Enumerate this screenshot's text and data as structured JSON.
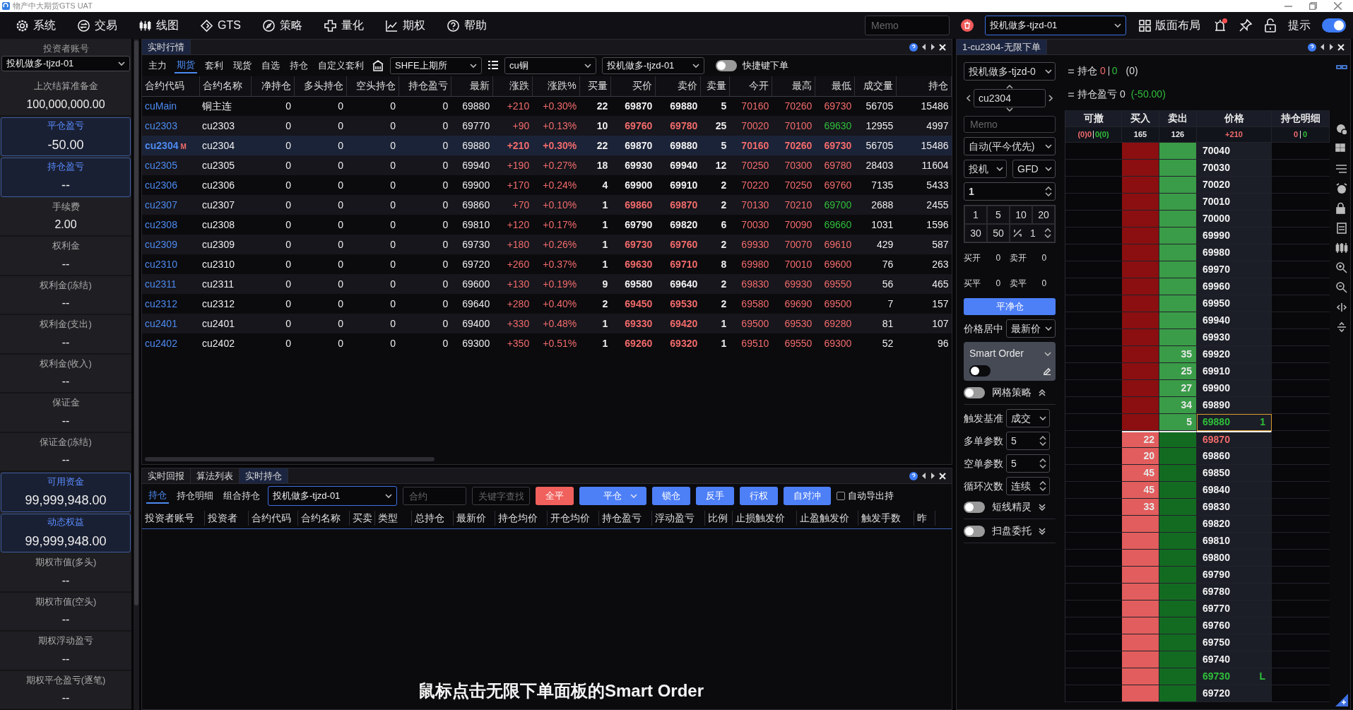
{
  "window": {
    "title": "物产中大期货GTS UAT"
  },
  "menu": [
    "系统",
    "交易",
    "线图",
    "GTS",
    "策略",
    "量化",
    "期权",
    "帮助"
  ],
  "toolbar": {
    "memo_placeholder": "Memo",
    "account": "投机做多-tjzd-01",
    "layout_label": "版面布局",
    "alert": true,
    "hint_label": "提示",
    "hint_on": true
  },
  "account_panel": {
    "title": "投资者账号",
    "account": "投机做多-tjzd-01",
    "fields": [
      {
        "label": "上次结算准备金",
        "value": "100,000,000.00",
        "highlighted": false
      },
      {
        "label": "平仓盈亏",
        "value": "-50.00",
        "highlighted": true
      },
      {
        "label": "持仓盈亏",
        "value": "--",
        "highlighted": true
      },
      {
        "label": "手续费",
        "value": "2.00",
        "highlighted": false
      },
      {
        "label": "权利金",
        "value": "--",
        "highlighted": false
      },
      {
        "label": "权利金(冻结)",
        "value": "--",
        "highlighted": false
      },
      {
        "label": "权利金(支出)",
        "value": "--",
        "highlighted": false
      },
      {
        "label": "权利金(收入)",
        "value": "--",
        "highlighted": false
      },
      {
        "label": "保证金",
        "value": "--",
        "highlighted": false
      },
      {
        "label": "保证金(冻结)",
        "value": "--",
        "highlighted": false
      },
      {
        "label": "可用资金",
        "value": "99,999,948.00",
        "highlighted": true
      },
      {
        "label": "动态权益",
        "value": "99,999,948.00",
        "highlighted": true
      },
      {
        "label": "期权市值(多头)",
        "value": "--",
        "highlighted": false
      },
      {
        "label": "期权市值(空头)",
        "value": "--",
        "highlighted": false
      },
      {
        "label": "期权浮动盈亏",
        "value": "--",
        "highlighted": false
      },
      {
        "label": "期权平仓盈亏(逐笔)",
        "value": "--",
        "highlighted": false
      }
    ]
  },
  "quotes": {
    "tab": "实时行情",
    "categories": [
      {
        "label": "主力",
        "selected": false
      },
      {
        "label": "期货",
        "selected": true
      },
      {
        "label": "套利",
        "selected": false
      },
      {
        "label": "现货",
        "selected": false
      },
      {
        "label": "自选",
        "selected": false
      },
      {
        "label": "持仓",
        "selected": false
      },
      {
        "label": "自定义套利",
        "selected": false
      }
    ],
    "exchange": "SHFE上期所",
    "product": "cu铜",
    "account": "投机做多-tjzd-01",
    "hotkey_label": "快捷键下单",
    "hotkey_on": false,
    "columns": [
      "合约代码",
      "合约名称",
      "净持仓",
      "多头持仓",
      "空头持仓",
      "持仓盈亏",
      "最新",
      "涨跌",
      "涨跌%",
      "买量",
      "买价",
      "卖价",
      "卖量",
      "今开",
      "最高",
      "最低",
      "成交量",
      "持仓"
    ],
    "rows": [
      {
        "code": "cuMain",
        "name": "铜主连",
        "net": "0",
        "long": "0",
        "short": "0",
        "pnl": "0",
        "last": "69880",
        "change": {
          "value": "+210",
          "color": "#f26b6b"
        },
        "change_pct": {
          "value": "+0.30%",
          "color": "#f26b6b"
        },
        "bid_vol": "22",
        "bid": {
          "value": "69870",
          "color": "#f2f2f2"
        },
        "ask": {
          "value": "69880",
          "color": "#f2f2f2"
        },
        "ask_vol": "5",
        "open": {
          "value": "70160",
          "color": "#f26b6b"
        },
        "high": {
          "value": "70260",
          "color": "#f26b6b"
        },
        "low": {
          "value": "69730",
          "color": "#f26b6b"
        },
        "volume": "56705",
        "open_interest": "15486",
        "selected": false
      },
      {
        "code": "cu2303",
        "name": "cu2303",
        "net": "0",
        "long": "0",
        "short": "0",
        "pnl": "0",
        "last": "69770",
        "change": {
          "value": "+90",
          "color": "#f26b6b"
        },
        "change_pct": {
          "value": "+0.13%",
          "color": "#f26b6b"
        },
        "bid_vol": "10",
        "bid": {
          "value": "69760",
          "color": "#f26b6b"
        },
        "ask": {
          "value": "69780",
          "color": "#f26b6b"
        },
        "ask_vol": "25",
        "open": {
          "value": "70020",
          "color": "#f26b6b"
        },
        "high": {
          "value": "70100",
          "color": "#f26b6b"
        },
        "low": {
          "value": "69630",
          "color": "#2fbf3a"
        },
        "volume": "12955",
        "open_interest": "4997",
        "selected": false
      },
      {
        "code": "cu2304",
        "marker": "M",
        "name": "cu2304",
        "net": "0",
        "long": "0",
        "short": "0",
        "pnl": "0",
        "last": "69880",
        "change": {
          "value": "+210",
          "color": "#f26b6b"
        },
        "change_pct": {
          "value": "+0.30%",
          "color": "#f26b6b"
        },
        "bid_vol": "22",
        "bid": {
          "value": "69870",
          "color": "#f2f2f2"
        },
        "ask": {
          "value": "69880",
          "color": "#f2f2f2"
        },
        "ask_vol": "5",
        "open": {
          "value": "70160",
          "color": "#f26b6b"
        },
        "high": {
          "value": "70260",
          "color": "#f26b6b"
        },
        "low": {
          "value": "69730",
          "color": "#f26b6b"
        },
        "volume": "56705",
        "open_interest": "15486",
        "selected": true
      },
      {
        "code": "cu2305",
        "name": "cu2305",
        "net": "0",
        "long": "0",
        "short": "0",
        "pnl": "0",
        "last": "69940",
        "change": {
          "value": "+190",
          "color": "#f26b6b"
        },
        "change_pct": {
          "value": "+0.27%",
          "color": "#f26b6b"
        },
        "bid_vol": "18",
        "bid": {
          "value": "69930",
          "color": "#f2f2f2"
        },
        "ask": {
          "value": "69940",
          "color": "#f2f2f2"
        },
        "ask_vol": "12",
        "open": {
          "value": "70250",
          "color": "#f26b6b"
        },
        "high": {
          "value": "70300",
          "color": "#f26b6b"
        },
        "low": {
          "value": "69780",
          "color": "#f26b6b"
        },
        "volume": "28403",
        "open_interest": "11604",
        "selected": false
      },
      {
        "code": "cu2306",
        "name": "cu2306",
        "net": "0",
        "long": "0",
        "short": "0",
        "pnl": "0",
        "last": "69900",
        "change": {
          "value": "+170",
          "color": "#f26b6b"
        },
        "change_pct": {
          "value": "+0.24%",
          "color": "#f26b6b"
        },
        "bid_vol": "4",
        "bid": {
          "value": "69900",
          "color": "#f2f2f2"
        },
        "ask": {
          "value": "69910",
          "color": "#f2f2f2"
        },
        "ask_vol": "2",
        "open": {
          "value": "70220",
          "color": "#f26b6b"
        },
        "high": {
          "value": "70250",
          "color": "#f26b6b"
        },
        "low": {
          "value": "69760",
          "color": "#f26b6b"
        },
        "volume": "7135",
        "open_interest": "5433",
        "selected": false
      },
      {
        "code": "cu2307",
        "name": "cu2307",
        "net": "0",
        "long": "0",
        "short": "0",
        "pnl": "0",
        "last": "69860",
        "change": {
          "value": "+70",
          "color": "#f26b6b"
        },
        "change_pct": {
          "value": "+0.10%",
          "color": "#f26b6b"
        },
        "bid_vol": "1",
        "bid": {
          "value": "69860",
          "color": "#f26b6b"
        },
        "ask": {
          "value": "69870",
          "color": "#f26b6b"
        },
        "ask_vol": "2",
        "open": {
          "value": "70130",
          "color": "#f26b6b"
        },
        "high": {
          "value": "70210",
          "color": "#f26b6b"
        },
        "low": {
          "value": "69700",
          "color": "#2fbf3a"
        },
        "volume": "2688",
        "open_interest": "2455",
        "selected": false
      },
      {
        "code": "cu2308",
        "name": "cu2308",
        "net": "0",
        "long": "0",
        "short": "0",
        "pnl": "0",
        "last": "69810",
        "change": {
          "value": "+120",
          "color": "#f26b6b"
        },
        "change_pct": {
          "value": "+0.17%",
          "color": "#f26b6b"
        },
        "bid_vol": "1",
        "bid": {
          "value": "69790",
          "color": "#f2f2f2"
        },
        "ask": {
          "value": "69820",
          "color": "#f2f2f2"
        },
        "ask_vol": "6",
        "open": {
          "value": "70030",
          "color": "#f26b6b"
        },
        "high": {
          "value": "70090",
          "color": "#f26b6b"
        },
        "low": {
          "value": "69660",
          "color": "#2fbf3a"
        },
        "volume": "1031",
        "open_interest": "1596",
        "selected": false
      },
      {
        "code": "cu2309",
        "name": "cu2309",
        "net": "0",
        "long": "0",
        "short": "0",
        "pnl": "0",
        "last": "69730",
        "change": {
          "value": "+180",
          "color": "#f26b6b"
        },
        "change_pct": {
          "value": "+0.26%",
          "color": "#f26b6b"
        },
        "bid_vol": "1",
        "bid": {
          "value": "69730",
          "color": "#f26b6b"
        },
        "ask": {
          "value": "69760",
          "color": "#f26b6b"
        },
        "ask_vol": "2",
        "open": {
          "value": "69930",
          "color": "#f26b6b"
        },
        "high": {
          "value": "70070",
          "color": "#f26b6b"
        },
        "low": {
          "value": "69610",
          "color": "#f26b6b"
        },
        "volume": "429",
        "open_interest": "587",
        "selected": false
      },
      {
        "code": "cu2310",
        "name": "cu2310",
        "net": "0",
        "long": "0",
        "short": "0",
        "pnl": "0",
        "last": "69720",
        "change": {
          "value": "+260",
          "color": "#f26b6b"
        },
        "change_pct": {
          "value": "+0.37%",
          "color": "#f26b6b"
        },
        "bid_vol": "1",
        "bid": {
          "value": "69630",
          "color": "#f26b6b"
        },
        "ask": {
          "value": "69710",
          "color": "#f26b6b"
        },
        "ask_vol": "8",
        "open": {
          "value": "69980",
          "color": "#f26b6b"
        },
        "high": {
          "value": "70010",
          "color": "#f26b6b"
        },
        "low": {
          "value": "69600",
          "color": "#f26b6b"
        },
        "volume": "76",
        "open_interest": "263",
        "selected": false
      },
      {
        "code": "cu2311",
        "name": "cu2311",
        "net": "0",
        "long": "0",
        "short": "0",
        "pnl": "0",
        "last": "69600",
        "change": {
          "value": "+130",
          "color": "#f26b6b"
        },
        "change_pct": {
          "value": "+0.19%",
          "color": "#f26b6b"
        },
        "bid_vol": "9",
        "bid": {
          "value": "69580",
          "color": "#f2f2f2"
        },
        "ask": {
          "value": "69640",
          "color": "#f2f2f2"
        },
        "ask_vol": "2",
        "open": {
          "value": "69830",
          "color": "#f26b6b"
        },
        "high": {
          "value": "69930",
          "color": "#f26b6b"
        },
        "low": {
          "value": "69550",
          "color": "#f26b6b"
        },
        "volume": "56",
        "open_interest": "465",
        "selected": false
      },
      {
        "code": "cu2312",
        "name": "cu2312",
        "net": "0",
        "long": "0",
        "short": "0",
        "pnl": "0",
        "last": "69640",
        "change": {
          "value": "+280",
          "color": "#f26b6b"
        },
        "change_pct": {
          "value": "+0.40%",
          "color": "#f26b6b"
        },
        "bid_vol": "2",
        "bid": {
          "value": "69450",
          "color": "#f26b6b"
        },
        "ask": {
          "value": "69530",
          "color": "#f26b6b"
        },
        "ask_vol": "2",
        "open": {
          "value": "69580",
          "color": "#f26b6b"
        },
        "high": {
          "value": "69690",
          "color": "#f26b6b"
        },
        "low": {
          "value": "69500",
          "color": "#f26b6b"
        },
        "volume": "7",
        "open_interest": "157",
        "selected": false
      },
      {
        "code": "cu2401",
        "name": "cu2401",
        "net": "0",
        "long": "0",
        "short": "0",
        "pnl": "0",
        "last": "69400",
        "change": {
          "value": "+330",
          "color": "#f26b6b"
        },
        "change_pct": {
          "value": "+0.48%",
          "color": "#f26b6b"
        },
        "bid_vol": "1",
        "bid": {
          "value": "69330",
          "color": "#f26b6b"
        },
        "ask": {
          "value": "69420",
          "color": "#f26b6b"
        },
        "ask_vol": "1",
        "open": {
          "value": "69500",
          "color": "#f26b6b"
        },
        "high": {
          "value": "69530",
          "color": "#f26b6b"
        },
        "low": {
          "value": "69280",
          "color": "#f26b6b"
        },
        "volume": "81",
        "open_interest": "107",
        "selected": false
      },
      {
        "code": "cu2402",
        "name": "cu2402",
        "net": "0",
        "long": "0",
        "short": "0",
        "pnl": "0",
        "last": "69300",
        "change": {
          "value": "+350",
          "color": "#f26b6b"
        },
        "change_pct": {
          "value": "+0.51%",
          "color": "#f26b6b"
        },
        "bid_vol": "1",
        "bid": {
          "value": "69260",
          "color": "#f26b6b"
        },
        "ask": {
          "value": "69320",
          "color": "#f26b6b"
        },
        "ask_vol": "1",
        "open": {
          "value": "69510",
          "color": "#f26b6b"
        },
        "high": {
          "value": "69550",
          "color": "#f26b6b"
        },
        "low": {
          "value": "69300",
          "color": "#f26b6b"
        },
        "volume": "52",
        "open_interest": "96",
        "selected": false
      }
    ]
  },
  "positions": {
    "tabs": [
      {
        "label": "实时回报",
        "selected": false
      },
      {
        "label": "算法列表",
        "selected": false
      },
      {
        "label": "实时持仓",
        "selected": true
      }
    ],
    "subtabs": [
      {
        "label": "持仓",
        "selected": true
      },
      {
        "label": "持仓明细",
        "selected": false
      },
      {
        "label": "组合持仓",
        "selected": false
      }
    ],
    "account": "投机做多-tjzd-01",
    "contract_placeholder": "合约",
    "keyword_placeholder": "关键字查找",
    "buttons": [
      {
        "label": "全平",
        "kind": "danger"
      },
      {
        "label": "平仓",
        "kind": "dropdown"
      },
      {
        "label": "锁仓",
        "kind": "primary"
      },
      {
        "label": "反手",
        "kind": "primary"
      },
      {
        "label": "行权",
        "kind": "primary"
      },
      {
        "label": "自对冲",
        "kind": "primary"
      }
    ],
    "auto_export": {
      "label": "自动导出持",
      "checked": false
    },
    "columns": [
      "投资者账号",
      "投资者",
      "合约代码",
      "合约名称",
      "买卖",
      "类型",
      "总持仓",
      "最新价",
      "持仓均价",
      "开仓均价",
      "持仓盈亏",
      "浮动盈亏",
      "比例",
      "止损触发价",
      "止盈触发价",
      "触发手数",
      "昨"
    ],
    "caption": "鼠标点击无限下单面板的Smart Order"
  },
  "order_panel": {
    "tab": "1-cu2304-无限下单",
    "account": "投机做多-tjzd-0",
    "contract": "cu2304",
    "memo_placeholder": "Memo",
    "mode": "自动(平今优先)",
    "hedge": "投机",
    "tif": "GFD",
    "quantity": "1",
    "quick_quantities": [
      "1",
      "5",
      "10",
      "20",
      "30",
      "50"
    ],
    "multiplier": "1",
    "stats": [
      {
        "label": "买开",
        "value": "0"
      },
      {
        "label": "卖开",
        "value": "0"
      },
      {
        "label": "买平",
        "value": "0"
      },
      {
        "label": "卖平",
        "value": "0"
      }
    ],
    "flatten_button": "平净仓",
    "center_label": "价格居中",
    "center_mode": "最新价",
    "smart_order": {
      "label": "Smart Order",
      "on": false
    },
    "grid_strategy": {
      "label": "网格策略",
      "on": false,
      "expanded": true
    },
    "params": [
      {
        "label": "触发基准",
        "value": "成交",
        "kind": "select"
      },
      {
        "label": "多单参数",
        "value": "5",
        "kind": "spin"
      },
      {
        "label": "空单参数",
        "value": "5",
        "kind": "spin"
      },
      {
        "label": "循环次数",
        "value": "连续",
        "kind": "spin"
      }
    ],
    "extras": [
      {
        "label": "短线精灵",
        "on": false,
        "expanded": false
      },
      {
        "label": "扫盘委托",
        "on": false,
        "expanded": false
      }
    ],
    "position": {
      "label": "持仓",
      "long": "0",
      "short": "0",
      "total": "(0)"
    },
    "pnl": {
      "label": "持仓盈亏",
      "value": "0",
      "close": "(-50.00)"
    },
    "ladder": {
      "columns": [
        "可撤",
        "买入",
        "卖出",
        "价格",
        "持仓明细"
      ],
      "summary": {
        "cancel_buy": "(0)0",
        "cancel_sell": "0(0)",
        "buy": "165",
        "sell": "126",
        "change": "+210",
        "hold_long": "0",
        "hold_short": "0"
      },
      "rows": [
        {
          "price": "70040",
          "kind": "ask",
          "color": "#f2f2f2",
          "current": false
        },
        {
          "price": "70030",
          "kind": "ask",
          "color": "#f2f2f2",
          "current": false
        },
        {
          "price": "70020",
          "kind": "ask",
          "color": "#f2f2f2",
          "current": false
        },
        {
          "price": "70010",
          "kind": "ask",
          "color": "#f2f2f2",
          "current": false
        },
        {
          "price": "70000",
          "kind": "ask",
          "color": "#f2f2f2",
          "current": false
        },
        {
          "price": "69990",
          "kind": "ask",
          "color": "#f2f2f2",
          "current": false
        },
        {
          "price": "69980",
          "kind": "ask",
          "color": "#f2f2f2",
          "current": false
        },
        {
          "price": "69970",
          "kind": "ask",
          "color": "#f2f2f2",
          "current": false
        },
        {
          "price": "69960",
          "kind": "ask",
          "color": "#f2f2f2",
          "current": false
        },
        {
          "price": "69950",
          "kind": "ask",
          "color": "#f2f2f2",
          "current": false
        },
        {
          "price": "69940",
          "kind": "ask",
          "color": "#f2f2f2",
          "current": false
        },
        {
          "price": "69930",
          "kind": "ask",
          "color": "#f2f2f2",
          "current": false
        },
        {
          "price": "69920",
          "ask": "35",
          "kind": "ask",
          "color": "#f2f2f2",
          "current": false
        },
        {
          "price": "69910",
          "ask": "25",
          "kind": "ask",
          "color": "#f2f2f2",
          "current": false
        },
        {
          "price": "69900",
          "ask": "27",
          "kind": "ask",
          "color": "#f2f2f2",
          "current": false
        },
        {
          "price": "69890",
          "ask": "34",
          "kind": "ask",
          "color": "#f2f2f2",
          "current": false
        },
        {
          "price": "69880",
          "ask": "5",
          "kind": "ask",
          "color": "#2fbf3a",
          "current": true,
          "flag": "1"
        },
        {
          "price": "69870",
          "bid": "22",
          "kind": "bid",
          "color": "#f26b6b",
          "current": false
        },
        {
          "price": "69860",
          "bid": "20",
          "kind": "bid",
          "color": "#f2f2f2",
          "current": false
        },
        {
          "price": "69850",
          "bid": "45",
          "kind": "bid",
          "color": "#f2f2f2",
          "current": false
        },
        {
          "price": "69840",
          "bid": "45",
          "kind": "bid",
          "color": "#f2f2f2",
          "current": false
        },
        {
          "price": "69830",
          "bid": "33",
          "kind": "bid",
          "color": "#f2f2f2",
          "current": false
        },
        {
          "price": "69820",
          "kind": "bid",
          "color": "#f2f2f2",
          "current": false
        },
        {
          "price": "69810",
          "kind": "bid",
          "color": "#f2f2f2",
          "current": false
        },
        {
          "price": "69800",
          "kind": "bid",
          "color": "#f2f2f2",
          "current": false
        },
        {
          "price": "69790",
          "kind": "bid",
          "color": "#f2f2f2",
          "current": false
        },
        {
          "price": "69780",
          "kind": "bid",
          "color": "#f2f2f2",
          "current": false
        },
        {
          "price": "69770",
          "kind": "bid",
          "color": "#f2f2f2",
          "current": false
        },
        {
          "price": "69760",
          "kind": "bid",
          "color": "#f2f2f2",
          "current": false
        },
        {
          "price": "69750",
          "kind": "bid",
          "color": "#f2f2f2",
          "current": false
        },
        {
          "price": "69740",
          "kind": "bid",
          "color": "#f2f2f2",
          "current": false
        },
        {
          "price": "69730",
          "kind": "bid",
          "color": "#2fbf3a",
          "current": false,
          "flag": "L"
        },
        {
          "price": "69720",
          "kind": "bid",
          "color": "#f2f2f2",
          "current": false
        }
      ]
    }
  }
}
